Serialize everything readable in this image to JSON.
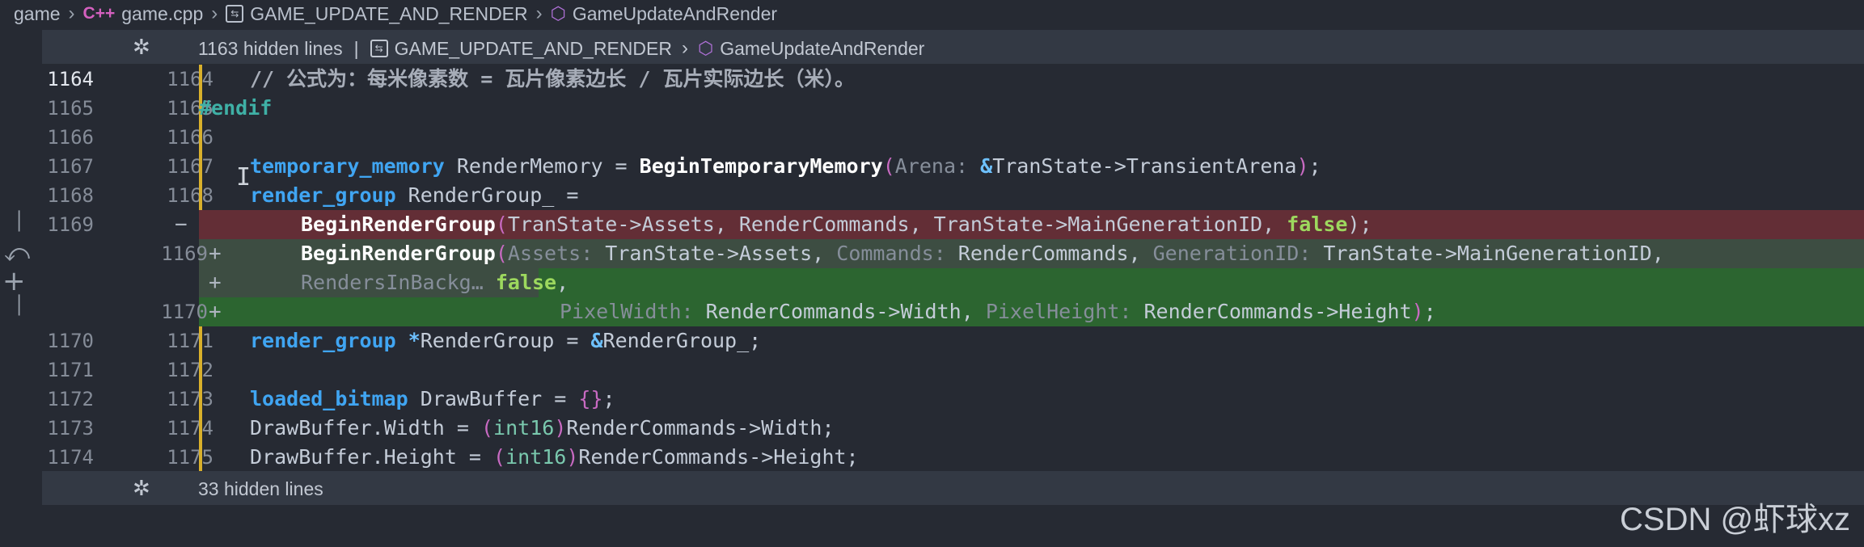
{
  "breadcrumb": {
    "items": [
      "game",
      "game.cpp",
      "GAME_UPDATE_AND_RENDER",
      "GameUpdateAndRender"
    ],
    "cpp_badge": "C++"
  },
  "fold_top": {
    "label": "1163 hidden lines",
    "scope": "GAME_UPDATE_AND_RENDER",
    "symbol": "GameUpdateAndRender"
  },
  "fold_bottom": {
    "label": "33 hidden lines"
  },
  "icons": {
    "fold": "unfold-icon",
    "revert": "revert-icon",
    "add": "plus-icon"
  },
  "lines": [
    {
      "old": "1164",
      "new": "1164",
      "mark": "",
      "kind": "ctx",
      "active": true
    },
    {
      "old": "1165",
      "new": "1165",
      "mark": "",
      "kind": "ctx"
    },
    {
      "old": "1166",
      "new": "1166",
      "mark": "",
      "kind": "ctx"
    },
    {
      "old": "1167",
      "new": "1167",
      "mark": "",
      "kind": "ctx"
    },
    {
      "old": "1168",
      "new": "1168",
      "mark": "",
      "kind": "ctx"
    },
    {
      "old": "1169",
      "new": "",
      "mark": "−",
      "kind": "del"
    },
    {
      "old": "",
      "new": "1169",
      "mark": "+",
      "kind": "add-dim"
    },
    {
      "old": "",
      "new": "",
      "mark": "+",
      "kind": "add-dim"
    },
    {
      "old": "",
      "new": "1170",
      "mark": "+",
      "kind": "add"
    },
    {
      "old": "1170",
      "new": "1171",
      "mark": "",
      "kind": "ctx"
    },
    {
      "old": "1171",
      "new": "1172",
      "mark": "",
      "kind": "ctx"
    },
    {
      "old": "1172",
      "new": "1173",
      "mark": "",
      "kind": "ctx"
    },
    {
      "old": "1173",
      "new": "1174",
      "mark": "",
      "kind": "ctx"
    },
    {
      "old": "1174",
      "new": "1175",
      "mark": "",
      "kind": "ctx"
    }
  ],
  "code": {
    "l1164": "// 公式为：每米像素数 = 瓦片像素边长 / 瓦片实际边长（米）。",
    "l1165": "#endif",
    "l1167_type": "temporary_memory",
    "l1167_var": " RenderMemory = ",
    "l1167_fn": "BeginTemporaryMemory",
    "l1167_hint": "Arena:",
    "l1167_arg": "TranState->TransientArena",
    "l1167_end": ";",
    "l1168_type": "render_group",
    "l1168_var": " RenderGroup_ =",
    "del_fn": "BeginRenderGroup",
    "del_args": "TranState->Assets, RenderCommands, TranState->MainGenerationID, ",
    "del_false": "false",
    "del_end": ");",
    "add_fn": "BeginRenderGroup",
    "add_h1": "Assets:",
    "add_a1": " TranState->Assets, ",
    "add_h2": "Commands:",
    "add_a2": " RenderCommands, ",
    "add_h3": "GenerationID:",
    "add_a3": " TranState->MainGenerationID,",
    "add_h4": "RendersInBackg…",
    "add_false": "false",
    "add_comma": ",",
    "add_h5": "PixelWidth:",
    "add_a5": " RenderCommands->Width, ",
    "add_h6": "PixelHeight:",
    "add_a6": " RenderCommands->Height",
    "add_end": ";",
    "l1171_type": "render_group",
    "l1171_rest": "RenderGroup = ",
    "l1171_var": "RenderGroup_;",
    "l1173_type": "loaded_bitmap",
    "l1173_var": " DrawBuffer = ",
    "l1173_end": ";",
    "l1174_a": "DrawBuffer.Width = ",
    "l1174_t": "int16",
    "l1174_b": "RenderCommands->Width;",
    "l1175_a": "DrawBuffer.Height = ",
    "l1175_t": "int16",
    "l1175_b": "RenderCommands->Height;"
  },
  "watermark": "CSDN @虾球xz"
}
